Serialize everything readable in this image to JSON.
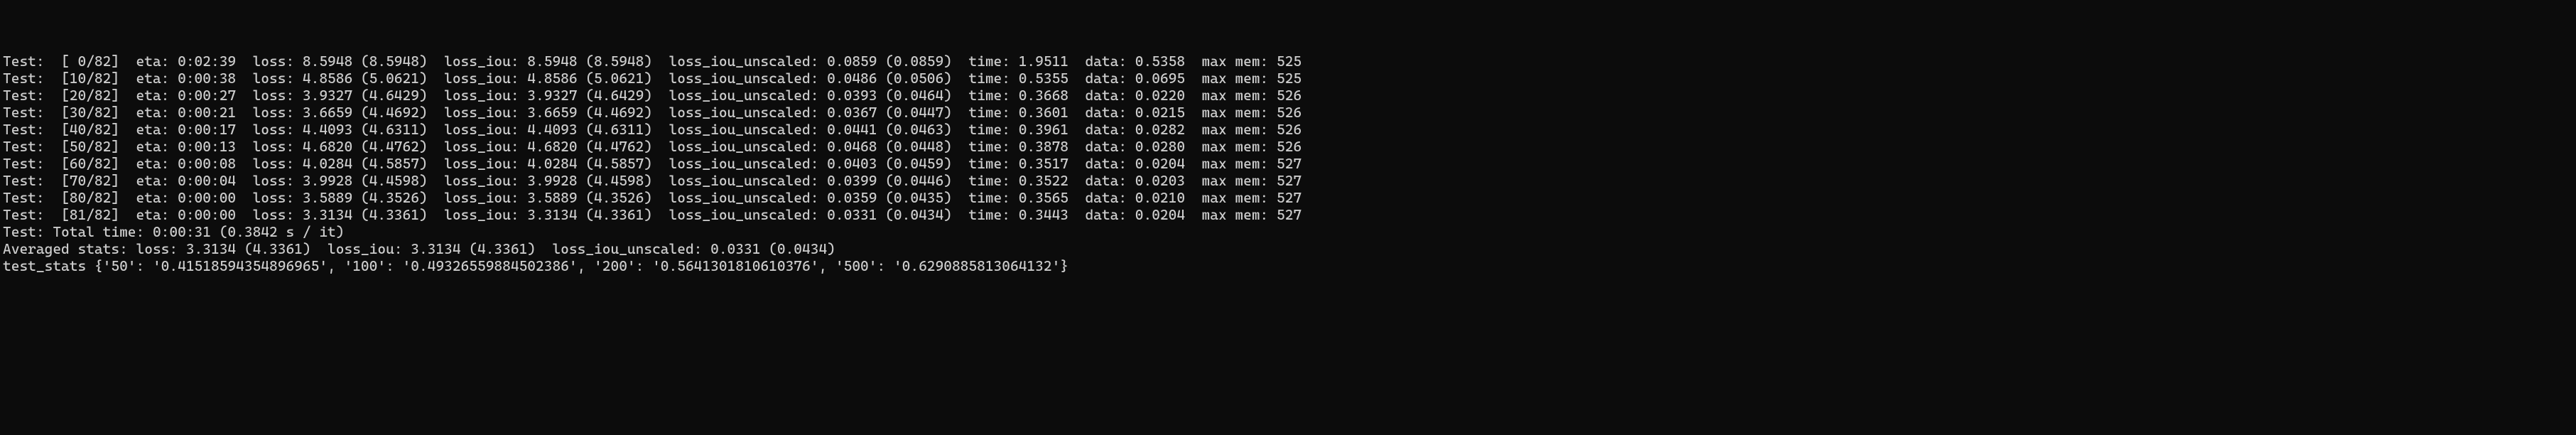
{
  "rows": [
    {
      "step": " 0",
      "eta": "0:02:39",
      "loss_cur": "8.5948",
      "loss_avg": "8.5948",
      "liou_cur": "8.5948",
      "liou_avg": "8.5948",
      "lu_cur": "0.0859",
      "lu_avg": "0.0859",
      "time": "1.9511",
      "data": "0.5358",
      "mem": "525"
    },
    {
      "step": "10",
      "eta": "0:00:38",
      "loss_cur": "4.8586",
      "loss_avg": "5.0621",
      "liou_cur": "4.8586",
      "liou_avg": "5.0621",
      "lu_cur": "0.0486",
      "lu_avg": "0.0506",
      "time": "0.5355",
      "data": "0.0695",
      "mem": "525"
    },
    {
      "step": "20",
      "eta": "0:00:27",
      "loss_cur": "3.9327",
      "loss_avg": "4.6429",
      "liou_cur": "3.9327",
      "liou_avg": "4.6429",
      "lu_cur": "0.0393",
      "lu_avg": "0.0464",
      "time": "0.3668",
      "data": "0.0220",
      "mem": "526"
    },
    {
      "step": "30",
      "eta": "0:00:21",
      "loss_cur": "3.6659",
      "loss_avg": "4.4692",
      "liou_cur": "3.6659",
      "liou_avg": "4.4692",
      "lu_cur": "0.0367",
      "lu_avg": "0.0447",
      "time": "0.3601",
      "data": "0.0215",
      "mem": "526"
    },
    {
      "step": "40",
      "eta": "0:00:17",
      "loss_cur": "4.4093",
      "loss_avg": "4.6311",
      "liou_cur": "4.4093",
      "liou_avg": "4.6311",
      "lu_cur": "0.0441",
      "lu_avg": "0.0463",
      "time": "0.3961",
      "data": "0.0282",
      "mem": "526"
    },
    {
      "step": "50",
      "eta": "0:00:13",
      "loss_cur": "4.6820",
      "loss_avg": "4.4762",
      "liou_cur": "4.6820",
      "liou_avg": "4.4762",
      "lu_cur": "0.0468",
      "lu_avg": "0.0448",
      "time": "0.3878",
      "data": "0.0280",
      "mem": "526"
    },
    {
      "step": "60",
      "eta": "0:00:08",
      "loss_cur": "4.0284",
      "loss_avg": "4.5857",
      "liou_cur": "4.0284",
      "liou_avg": "4.5857",
      "lu_cur": "0.0403",
      "lu_avg": "0.0459",
      "time": "0.3517",
      "data": "0.0204",
      "mem": "527"
    },
    {
      "step": "70",
      "eta": "0:00:04",
      "loss_cur": "3.9928",
      "loss_avg": "4.4598",
      "liou_cur": "3.9928",
      "liou_avg": "4.4598",
      "lu_cur": "0.0399",
      "lu_avg": "0.0446",
      "time": "0.3522",
      "data": "0.0203",
      "mem": "527"
    },
    {
      "step": "80",
      "eta": "0:00:00",
      "loss_cur": "3.5889",
      "loss_avg": "4.3526",
      "liou_cur": "3.5889",
      "liou_avg": "4.3526",
      "lu_cur": "0.0359",
      "lu_avg": "0.0435",
      "time": "0.3565",
      "data": "0.0210",
      "mem": "527"
    },
    {
      "step": "81",
      "eta": "0:00:00",
      "loss_cur": "3.3134",
      "loss_avg": "4.3361",
      "liou_cur": "3.3134",
      "liou_avg": "4.3361",
      "lu_cur": "0.0331",
      "lu_avg": "0.0434",
      "time": "0.3443",
      "data": "0.0204",
      "mem": "527"
    }
  ],
  "total": 82,
  "totals": {
    "total_time": "0:00:31",
    "per_it": "0.3842"
  },
  "averaged": {
    "loss_cur": "3.3134",
    "loss_avg": "4.3361",
    "liou_cur": "3.3134",
    "liou_avg": "4.3361",
    "lu_cur": "0.0331",
    "lu_avg": "0.0434"
  },
  "test_stats": {
    "50": "0.41518594354896965",
    "100": "0.49326559884502386",
    "200": "0.5641301810610376",
    "500": "0.6290885813064132"
  },
  "labels": {
    "prefix": "Test:",
    "eta": "eta:",
    "loss": "loss:",
    "loss_iou": "loss_iou:",
    "loss_iou_unscaled": "loss_iou_unscaled:",
    "time": "time:",
    "data": "data:",
    "max_mem": "max mem:",
    "total_time": "Total time:",
    "s_per_it": "s / it",
    "averaged": "Averaged stats:",
    "test_stats": "test_stats"
  }
}
